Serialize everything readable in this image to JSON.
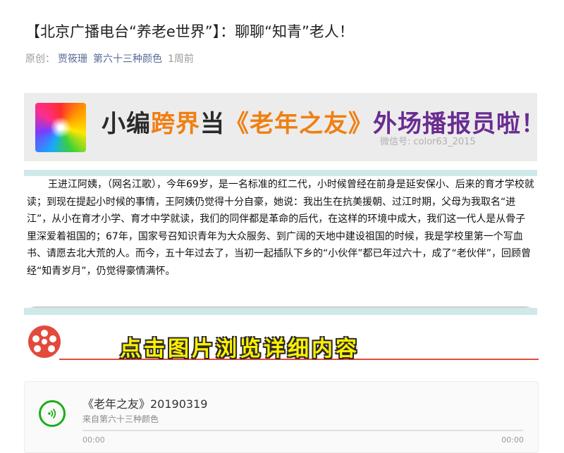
{
  "article": {
    "title": "【北京广播电台“养老e世界”】：聊聊“知青”老人！",
    "meta": {
      "original_label": "原创：",
      "author": "贾筱珊",
      "account": "第六十三种颜色",
      "time": "1周前"
    }
  },
  "banner": {
    "part1": "小编",
    "part2": "跨界",
    "part3": "当",
    "part4": "《老年之友》",
    "part5": "外场播报员啦！",
    "watermark": "微信号: color63_2015"
  },
  "body_text": "王进江阿姨，（网名江歌），今年69岁，是一名标准的红二代，小时候曾经在前身是延安保小、后来的育才学校就读；到现在提起小时候的事情，王阿姨仍觉得十分自豪，她说：我出生在抗美援朝、过江时期，父母为我取名“进江”，从小在育才小学、育才中学就读，我们的同伴都是革命的后代，在这样的环境中成大，我们这一代人是从骨子里深爱着祖国的；67年，国家号召知识青年为大众服务、到广阔的天地中建设祖国的时候，我是学校里第一个写血书、请愿去北大荒的人。而今，五十年过去了，当初一起插队下乡的“小伙伴”都已年过六十，成了“老伙伴”，回顾曾经“知青岁月”，仍觉得豪情满怀。",
  "cta": {
    "label": "点击图片浏览详细内容"
  },
  "audio": {
    "title": "《老年之友》20190319",
    "source": "来自第六十三种颜色",
    "time_current": "00:00",
    "time_total": "00:00"
  },
  "colors": {
    "accent_green": "#1aad19",
    "link_blue": "#576b95",
    "reel_red": "#e24a3b",
    "cta_yellow": "#fff000",
    "banner_orange": "#f07f12",
    "banner_purple": "#6a2c91"
  }
}
